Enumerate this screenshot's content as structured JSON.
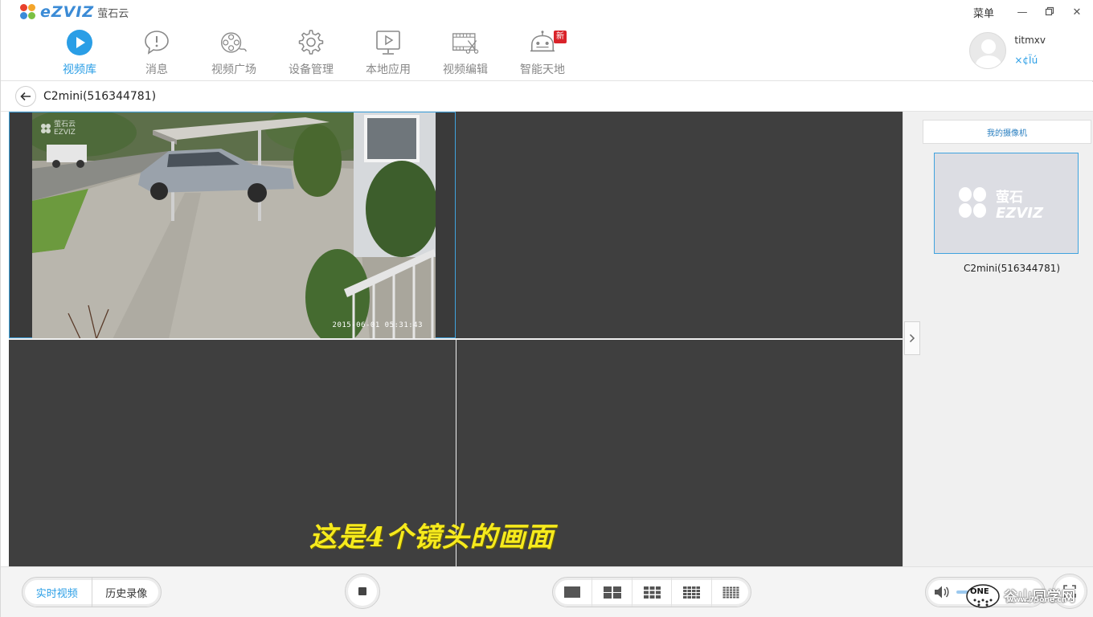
{
  "app": {
    "logo_text": "eZVIZ",
    "logo_cn": "萤石云",
    "brand_color": "#2a9ee6"
  },
  "window": {
    "menu_label": "菜单",
    "minimize_icon": "minimize-icon",
    "restore_icon": "restore-icon"
  },
  "nav": {
    "items": [
      {
        "label": "视频库",
        "icon": "play-circle-icon",
        "active": true
      },
      {
        "label": "消息",
        "icon": "message-icon",
        "active": false
      },
      {
        "label": "视频广场",
        "icon": "film-reel-icon",
        "active": false
      },
      {
        "label": "设备管理",
        "icon": "gear-icon",
        "active": false
      },
      {
        "label": "本地应用",
        "icon": "monitor-play-icon",
        "active": false
      },
      {
        "label": "视频编辑",
        "icon": "film-scissors-icon",
        "active": false
      },
      {
        "label": "智能天地",
        "icon": "robot-icon",
        "active": false,
        "badge": "新"
      }
    ]
  },
  "user": {
    "name": "titmxv",
    "sub": "×¢Ïú"
  },
  "breadcrumb": {
    "title": "C2mini(516344781)"
  },
  "video": {
    "timestamp": "2015-06-01 05:31:43",
    "watermark_cn": "萤石云",
    "watermark_en": "EZVIZ"
  },
  "caption": "这是4个镜头的画面",
  "sidebar": {
    "header": "我的摄像机",
    "thumb_logo_cn": "萤石",
    "thumb_logo_en": "EZVIZ",
    "camera_name": "C2mini(516344781)"
  },
  "bottom": {
    "mode_live": "实时视频",
    "mode_history": "历史录像",
    "site_watermark": "谷山同学网",
    "site_watermark_url": "www.75one.cn"
  }
}
